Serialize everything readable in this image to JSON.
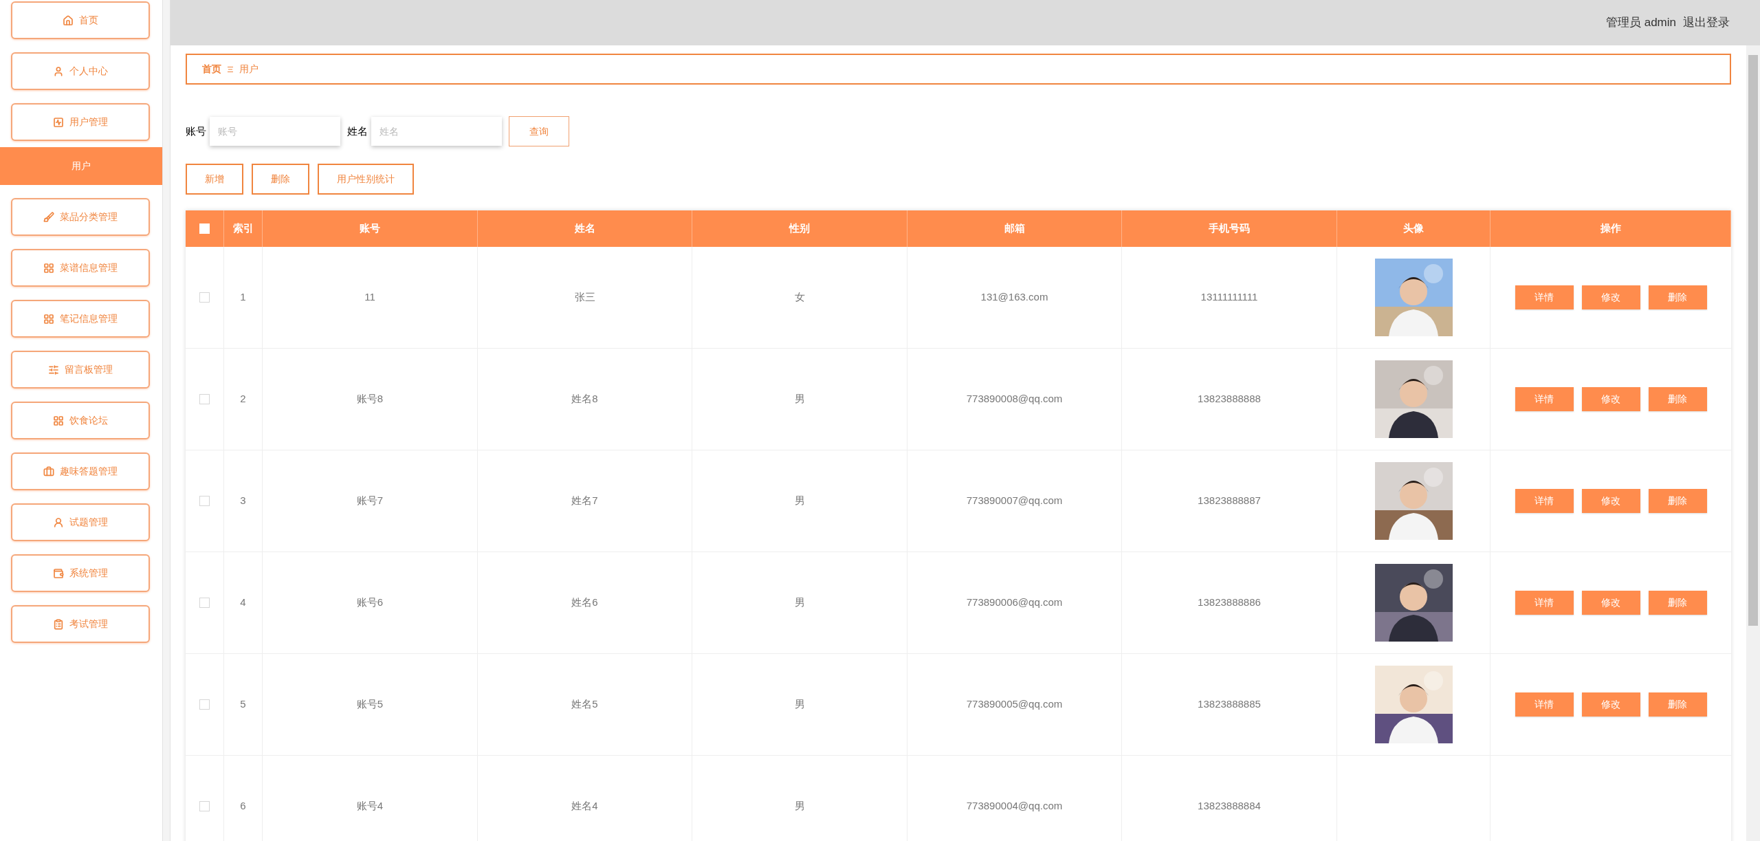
{
  "sidebar": {
    "items": [
      {
        "label": "首页",
        "selected": false
      },
      {
        "label": "个人中心",
        "selected": false
      },
      {
        "label": "用户管理",
        "selected": false,
        "children": [
          {
            "label": "用户",
            "selected": true
          }
        ]
      },
      {
        "label": "菜品分类管理",
        "selected": false
      },
      {
        "label": "菜谱信息管理",
        "selected": false
      },
      {
        "label": "笔记信息管理",
        "selected": false
      },
      {
        "label": "留言板管理",
        "selected": false
      },
      {
        "label": "饮食论坛",
        "selected": false
      },
      {
        "label": "趣味答题管理",
        "selected": false
      },
      {
        "label": "试题管理",
        "selected": false
      },
      {
        "label": "系统管理",
        "selected": false
      },
      {
        "label": "考试管理",
        "selected": false
      }
    ]
  },
  "header": {
    "user": "管理员 admin",
    "logout": "退出登录"
  },
  "breadcrumb": [
    "首页",
    "用户"
  ],
  "search": {
    "fields": [
      {
        "label": "账号",
        "placeholder": "账号"
      },
      {
        "label": "姓名",
        "placeholder": "姓名"
      }
    ],
    "button": "查询"
  },
  "actions": [
    "新增",
    "删除",
    "用户性别统计"
  ],
  "table": {
    "select_all": {
      "checked": false
    },
    "columns": [
      "索引",
      "账号",
      "姓名",
      "性别",
      "邮箱",
      "手机号码",
      "头像",
      "操作"
    ],
    "rows": [
      {
        "checked": false,
        "cells": [
          "1",
          "11",
          "张三",
          "女",
          "131@163.com",
          "13111111111"
        ],
        "buttons": [
          "详情",
          "修改",
          "删除"
        ]
      },
      {
        "checked": false,
        "cells": [
          "2",
          "账号8",
          "姓名8",
          "男",
          "773890008@qq.com",
          "13823888888"
        ],
        "buttons": [
          "详情",
          "修改",
          "删除"
        ]
      },
      {
        "checked": false,
        "cells": [
          "3",
          "账号7",
          "姓名7",
          "男",
          "773890007@qq.com",
          "13823888887"
        ],
        "buttons": [
          "详情",
          "修改",
          "删除"
        ]
      },
      {
        "checked": false,
        "cells": [
          "4",
          "账号6",
          "姓名6",
          "男",
          "773890006@qq.com",
          "13823888886"
        ],
        "buttons": [
          "详情",
          "修改",
          "删除"
        ]
      },
      {
        "checked": false,
        "cells": [
          "5",
          "账号5",
          "姓名5",
          "男",
          "773890005@qq.com",
          "13823888885"
        ],
        "buttons": [
          "详情",
          "修改",
          "删除"
        ]
      },
      {
        "checked": false,
        "cells": [
          "6",
          "账号4",
          "姓名4",
          "男",
          "773890004@qq.com",
          "13823888884"
        ]
      }
    ]
  }
}
